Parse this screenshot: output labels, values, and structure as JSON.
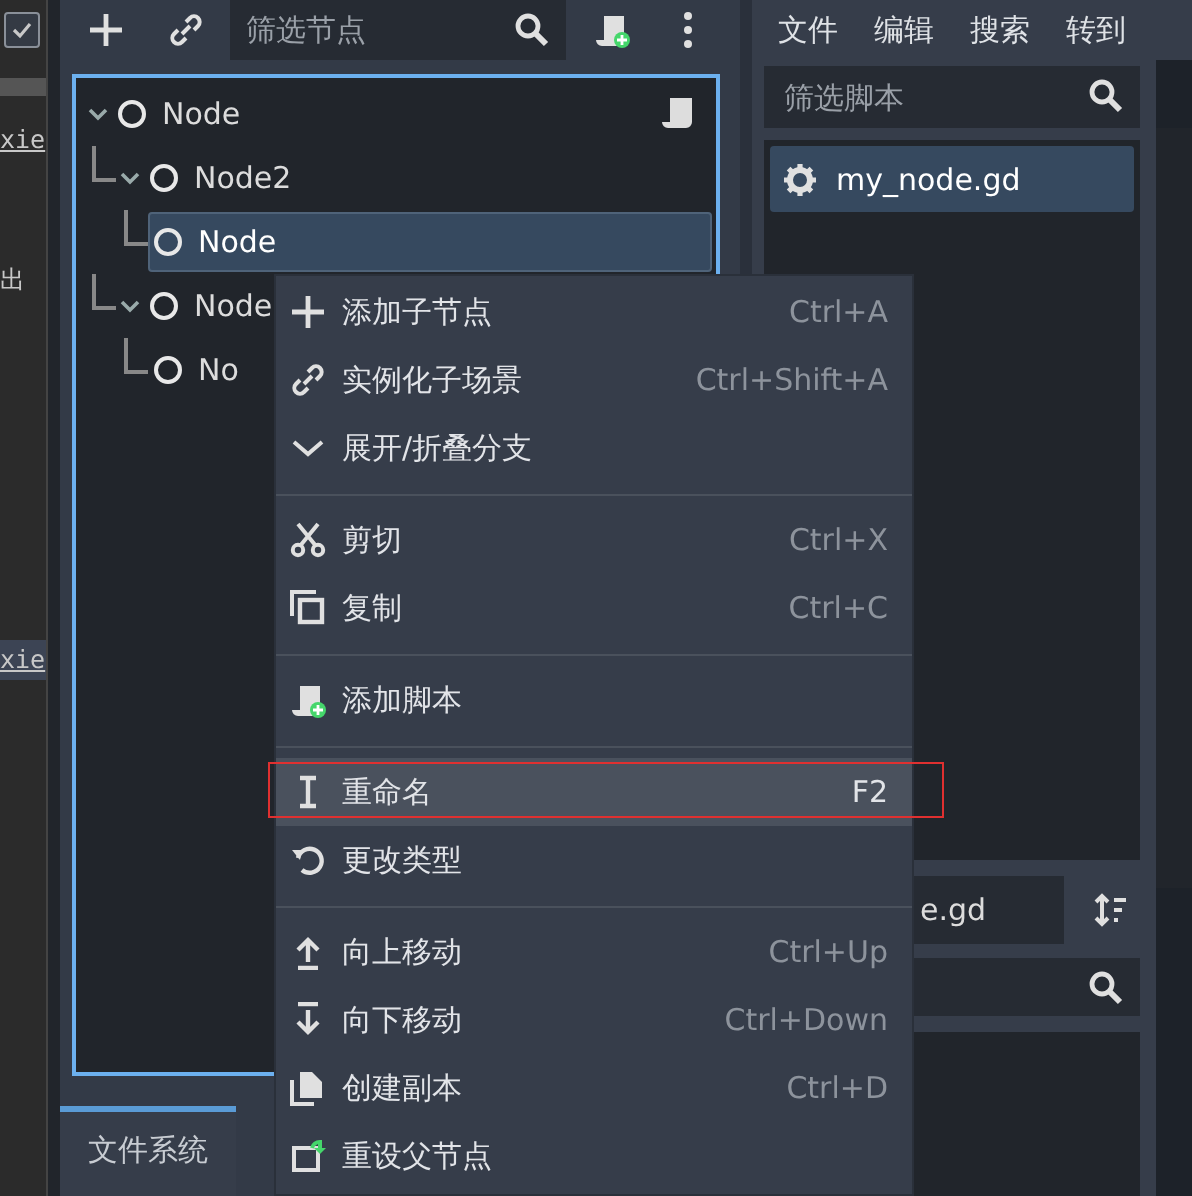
{
  "left_strip": {
    "checked": true,
    "texts": [
      "xie",
      "出",
      "xie"
    ]
  },
  "scene_dock": {
    "filter": {
      "placeholder": "筛选节点"
    },
    "tree": [
      {
        "name": "Node",
        "expanded": true,
        "selected": false,
        "has_script": true,
        "children": [
          {
            "name": "Node2",
            "expanded": true,
            "selected": false,
            "children": [
              {
                "name": "Node",
                "selected": true
              }
            ]
          },
          {
            "name": "Node",
            "expanded": true,
            "selected": false,
            "children": [
              {
                "name": "No",
                "selected": false
              }
            ]
          }
        ]
      }
    ],
    "tabs": [
      {
        "label": "文件系统",
        "selected": true
      }
    ]
  },
  "script_panel": {
    "menu": [
      "文件",
      "编辑",
      "搜索",
      "转到"
    ],
    "filter": {
      "placeholder": "筛选脚本"
    },
    "scripts": [
      {
        "name": "my_node.gd",
        "selected": true
      }
    ],
    "current_script": "e.gd"
  },
  "context_menu": {
    "groups": [
      [
        {
          "label": "添加子节点",
          "shortcut": "Ctrl+A",
          "highlighted": false
        },
        {
          "label": "实例化子场景",
          "shortcut": "Ctrl+Shift+A",
          "highlighted": false
        },
        {
          "label": "展开/折叠分支",
          "highlighted": false
        }
      ],
      [
        {
          "label": "剪切",
          "shortcut": "Ctrl+X",
          "highlighted": false
        },
        {
          "label": "复制",
          "shortcut": "Ctrl+C",
          "highlighted": false
        }
      ],
      [
        {
          "label": "添加脚本",
          "highlighted": false
        }
      ],
      [
        {
          "label": "重命名",
          "shortcut": "F2",
          "highlighted": true
        },
        {
          "label": "更改类型",
          "highlighted": false
        }
      ],
      [
        {
          "label": "向上移动",
          "shortcut": "Ctrl+Up",
          "highlighted": false
        },
        {
          "label": "向下移动",
          "shortcut": "Ctrl+Down",
          "highlighted": false
        },
        {
          "label": "创建副本",
          "shortcut": "Ctrl+D",
          "highlighted": false
        },
        {
          "label": "重设父节点",
          "highlighted": false
        }
      ]
    ]
  }
}
